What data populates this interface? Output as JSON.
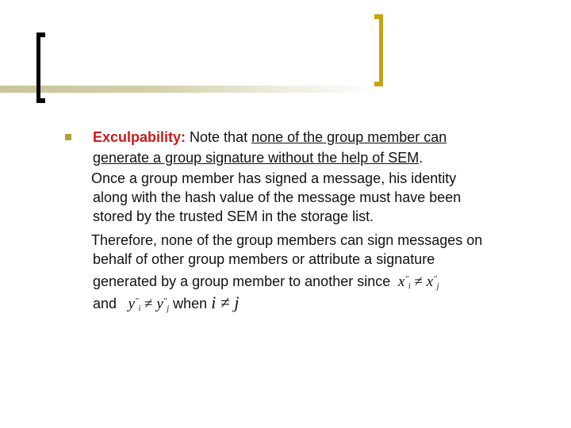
{
  "slide": {
    "bullet": {
      "term": "Exculpability:",
      "intro": " Note that ",
      "underlined_line1": "none of the group member can",
      "underlined_line2": "generate a group signature without the help of SEM",
      "period": "."
    },
    "paragraph1": [
      "Once a group member has signed a message, his identity",
      "along with the hash value of the message must have been",
      "stored by the trusted SEM in the storage list."
    ],
    "paragraph2": [
      "Therefore, none of the group members can sign messages on",
      "behalf of other group members or attribute a signature",
      "generated by a group member to another since"
    ],
    "last_line": {
      "and": "and",
      "when": "when"
    },
    "math": {
      "x_base": "x",
      "y_base": "y",
      "prime": "″",
      "i": "i",
      "j": "j",
      "neq": "≠"
    },
    "colors": {
      "term": "#cc1a1a",
      "bullet": "#b5a03a",
      "right_bracket": "#c9a010"
    }
  }
}
